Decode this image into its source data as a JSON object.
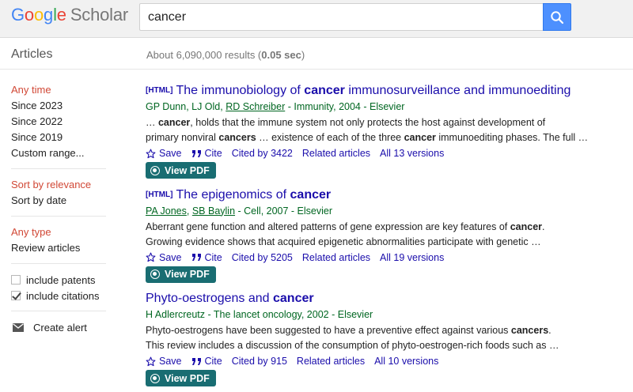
{
  "logo": {
    "letters": [
      "G",
      "o",
      "o",
      "g",
      "l",
      "e"
    ],
    "letter_colors": [
      "#4285f4",
      "#ea4335",
      "#fbbc05",
      "#4285f4",
      "#34a853",
      "#ea4335"
    ],
    "product": "Scholar"
  },
  "search": {
    "query": "cancer",
    "button_icon": "search-icon"
  },
  "subbar": {
    "section": "Articles",
    "stats_prefix": "About 6,090,000 results (",
    "stats_time": "0.05 sec",
    "stats_suffix": ")"
  },
  "sidebar": {
    "time_filters": [
      "Any time",
      "Since 2023",
      "Since 2022",
      "Since 2019",
      "Custom range..."
    ],
    "sort_options": [
      "Sort by relevance",
      "Sort by date"
    ],
    "type_filters": [
      "Any type",
      "Review articles"
    ],
    "checkboxes": [
      {
        "label": "include patents",
        "checked": false
      },
      {
        "label": "include citations",
        "checked": true
      }
    ],
    "alert_label": "Create alert"
  },
  "results": [
    {
      "tag": "[HTML]",
      "title_parts": [
        "The immunobiology of ",
        "cancer",
        " immunosurveillance and immunoediting"
      ],
      "authors_plain": "GP Dunn, LJ Old, ",
      "authors_linked": [
        "RD Schreiber"
      ],
      "source": " - Immunity, 2004 - Elsevier",
      "snippet_lines": [
        [
          "… ",
          "cancer",
          ", holds that the immune system not only protects the host against development of"
        ],
        [
          "primary nonviral ",
          "cancers",
          " … existence of each of the three ",
          "cancer",
          " immunoediting phases. The full …"
        ]
      ],
      "actions": {
        "save": "Save",
        "cite": "Cite",
        "cited_by": "Cited by 3422",
        "related": "Related articles",
        "versions": "All 13 versions"
      },
      "pdf_label": "View PDF"
    },
    {
      "tag": "[HTML]",
      "title_parts": [
        "The epigenomics of ",
        "cancer",
        ""
      ],
      "authors_plain": "",
      "authors_linked": [
        "PA Jones",
        "SB Baylin"
      ],
      "source": " - Cell, 2007 - Elsevier",
      "snippet_lines": [
        [
          "Aberrant gene function and altered patterns of gene expression are key features of ",
          "cancer",
          "."
        ],
        [
          "Growing evidence shows that acquired epigenetic abnormalities participate with genetic …"
        ]
      ],
      "actions": {
        "save": "Save",
        "cite": "Cite",
        "cited_by": "Cited by 5205",
        "related": "Related articles",
        "versions": "All 19 versions"
      },
      "pdf_label": "View PDF"
    },
    {
      "tag": "",
      "title_parts": [
        "Phyto-oestrogens and ",
        "cancer",
        ""
      ],
      "authors_plain": "H Adlercreutz",
      "authors_linked": [],
      "source": " - The lancet oncology, 2002 - Elsevier",
      "snippet_lines": [
        [
          "Phyto-oestrogens have been suggested to have a preventive effect against various ",
          "cancers",
          "."
        ],
        [
          "This review includes a discussion of the consumption of phyto-oestrogen-rich foods such as …"
        ]
      ],
      "actions": {
        "save": "Save",
        "cite": "Cite",
        "cited_by": "Cited by 915",
        "related": "Related articles",
        "versions": "All 10 versions"
      },
      "pdf_label": "View PDF"
    }
  ],
  "colors": {
    "link": "#1a0dab",
    "author_green": "#006621",
    "selected_red": "#d14836",
    "pdf_teal": "#196d72",
    "search_blue": "#4d90fe"
  }
}
